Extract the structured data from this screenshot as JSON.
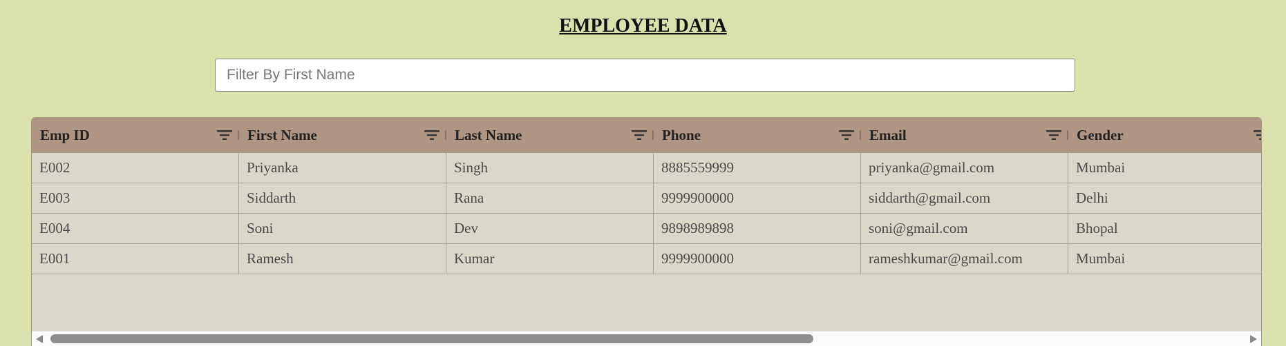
{
  "page": {
    "title": "EMPLOYEE DATA"
  },
  "filter": {
    "placeholder": "Filter By First Name",
    "value": ""
  },
  "table": {
    "columns": [
      {
        "label": "Emp ID",
        "filter_icon": "filter-lines-icon"
      },
      {
        "label": "First Name",
        "filter_icon": "filter-lines-icon"
      },
      {
        "label": "Last Name",
        "filter_icon": "filter-lines-icon"
      },
      {
        "label": "Phone",
        "filter_icon": "filter-lines-icon"
      },
      {
        "label": "Email",
        "filter_icon": "filter-lines-icon"
      },
      {
        "label": "Gender",
        "filter_icon": "filter-lines-icon"
      }
    ],
    "rows": [
      [
        "E002",
        "Priyanka",
        "Singh",
        "8885559999",
        "priyanka@gmail.com",
        "Mumbai"
      ],
      [
        "E003",
        "Siddarth",
        "Rana",
        "9999900000",
        "siddarth@gmail.com",
        "Delhi"
      ],
      [
        "E004",
        "Soni",
        "Dev",
        "9898989898",
        "soni@gmail.com",
        "Bhopal"
      ],
      [
        "E001",
        "Ramesh",
        "Kumar",
        "9999900000",
        "rameshkumar@gmail.com",
        "Mumbai"
      ]
    ]
  },
  "scroll": {
    "horizontal_visible_fraction": 0.64
  },
  "colors": {
    "background": "#dbe1ac",
    "header": "#af9584",
    "grid_body": "#dbd7ca"
  }
}
